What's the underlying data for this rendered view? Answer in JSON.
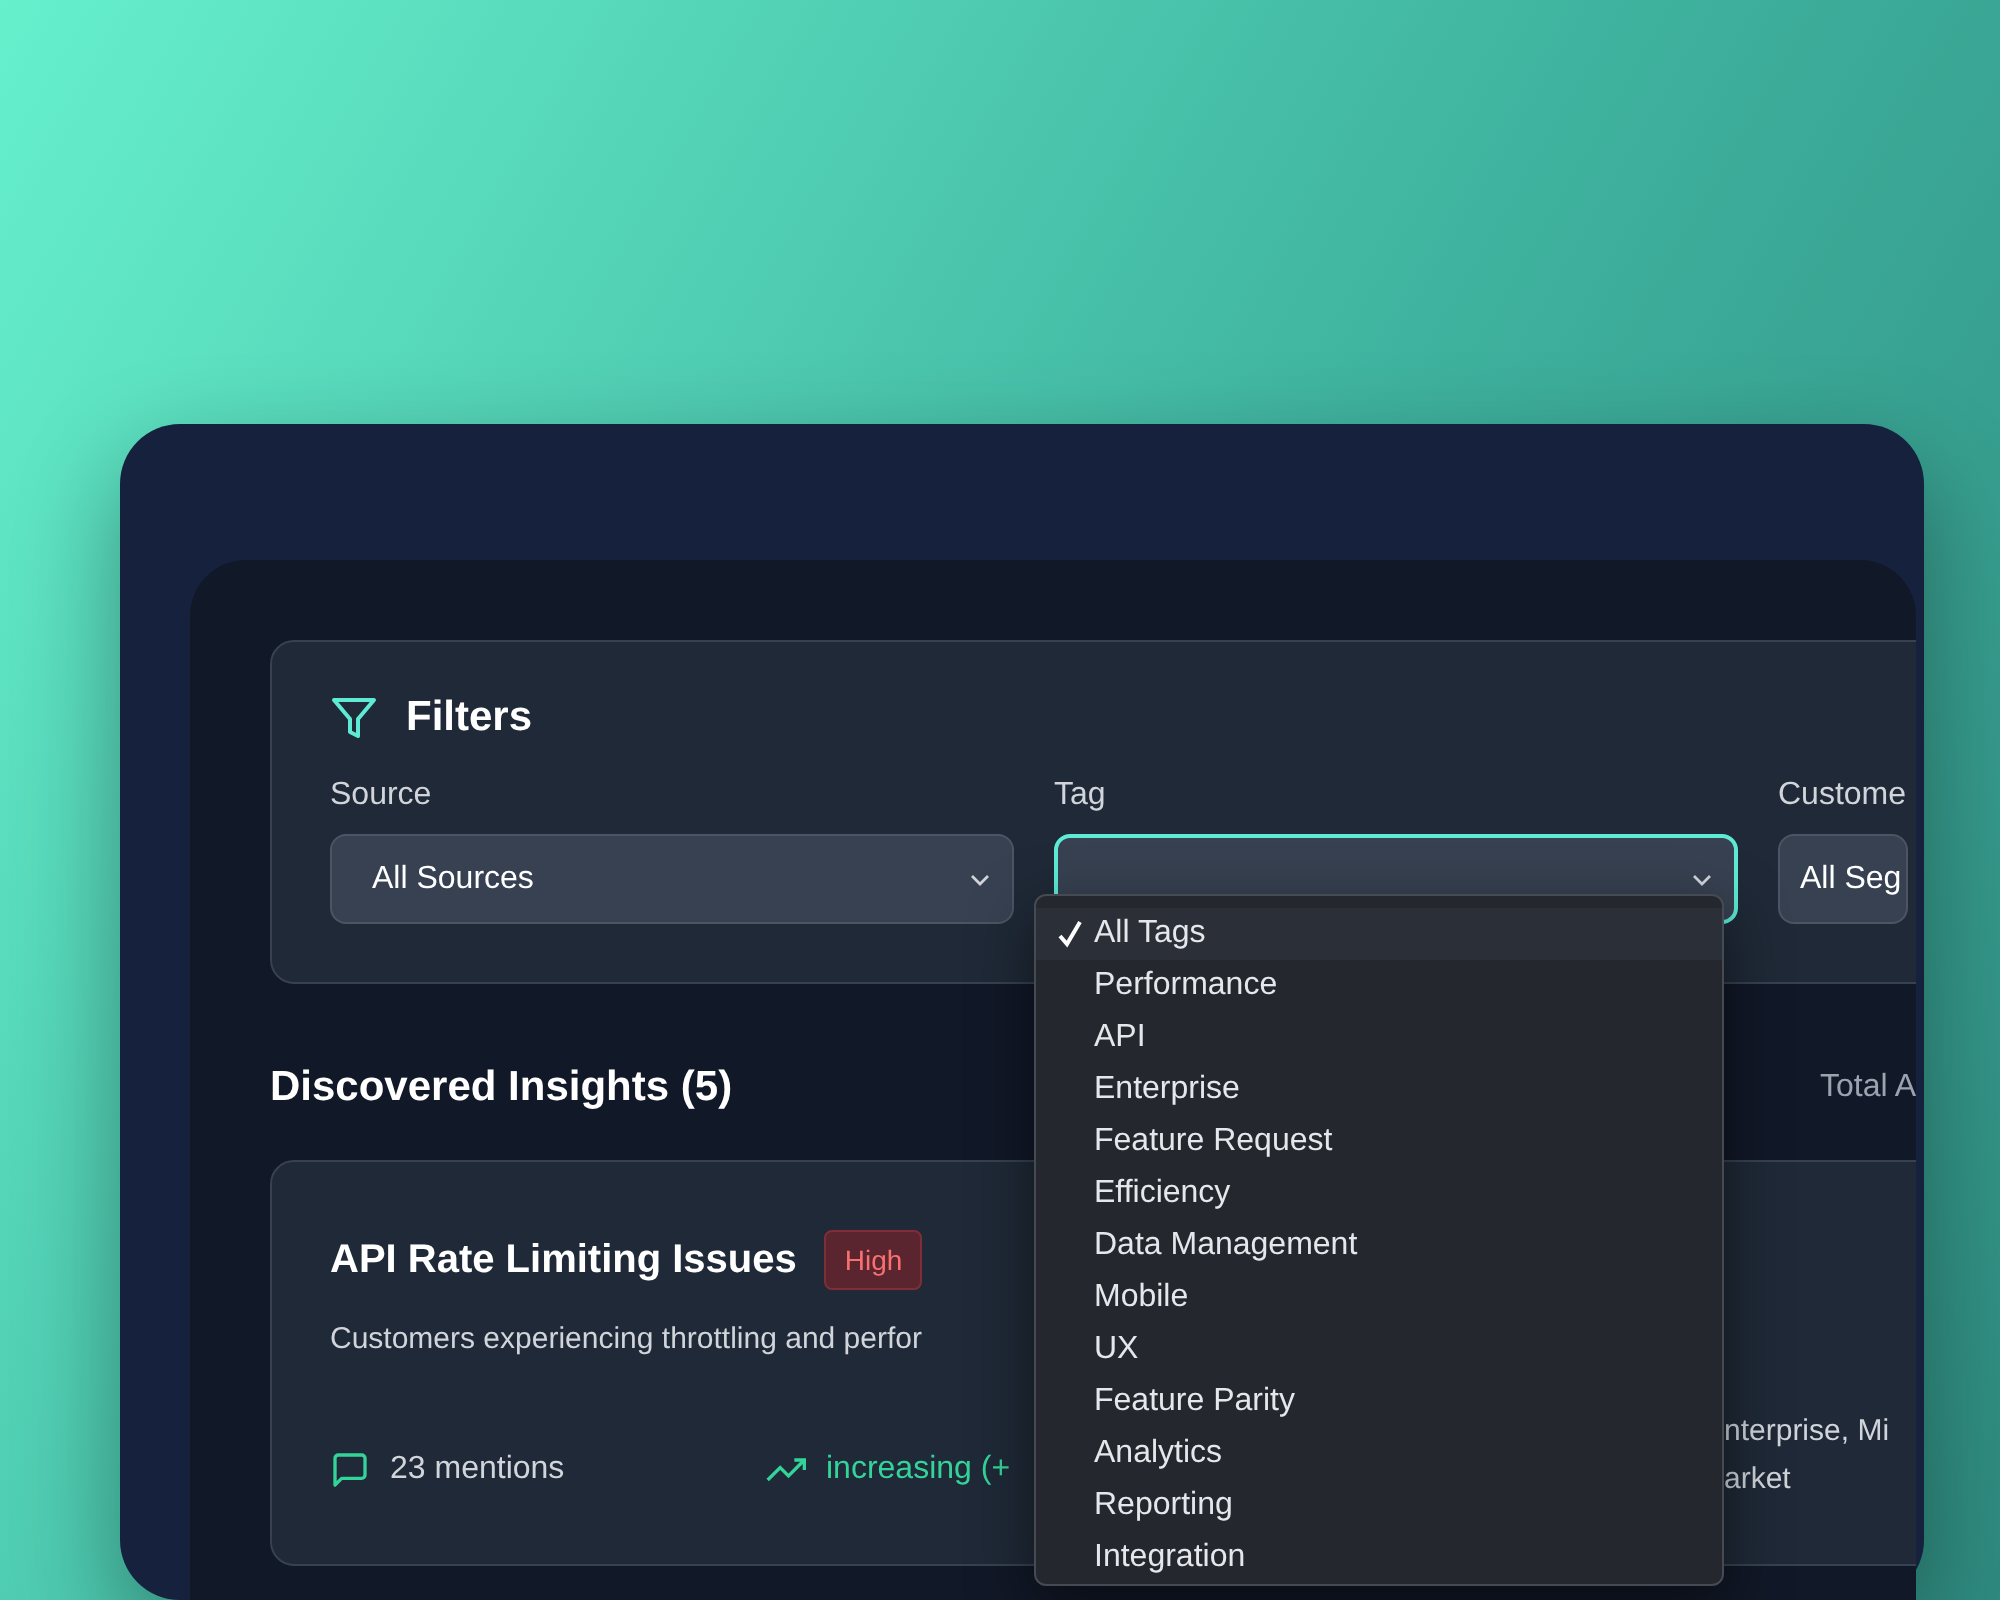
{
  "filters": {
    "title": "Filters",
    "fields": [
      {
        "label": "Source",
        "value": "All Sources",
        "focused": false
      },
      {
        "label": "Tag",
        "focused": true
      },
      {
        "label": "Custome",
        "value": "All Seg",
        "focused": false
      }
    ]
  },
  "tag_dropdown": {
    "options": [
      {
        "label": "All Tags",
        "selected": true
      },
      {
        "label": "Performance",
        "selected": false
      },
      {
        "label": "API",
        "selected": false
      },
      {
        "label": "Enterprise",
        "selected": false
      },
      {
        "label": "Feature Request",
        "selected": false
      },
      {
        "label": "Efficiency",
        "selected": false
      },
      {
        "label": "Data Management",
        "selected": false
      },
      {
        "label": "Mobile",
        "selected": false
      },
      {
        "label": "UX",
        "selected": false
      },
      {
        "label": "Feature Parity",
        "selected": false
      },
      {
        "label": "Analytics",
        "selected": false
      },
      {
        "label": "Reporting",
        "selected": false
      },
      {
        "label": "Integration",
        "selected": false
      }
    ]
  },
  "insights": {
    "heading": "Discovered Insights (5)",
    "summary": "Total A",
    "cards": [
      {
        "title": "API Rate Limiting Issues",
        "priority": "High",
        "description": "Customers experiencing throttling and perfor",
        "mentions": "23 mentions",
        "trend": "increasing (+",
        "segments": [
          "nterprise, Mi",
          "arket"
        ]
      }
    ]
  }
}
